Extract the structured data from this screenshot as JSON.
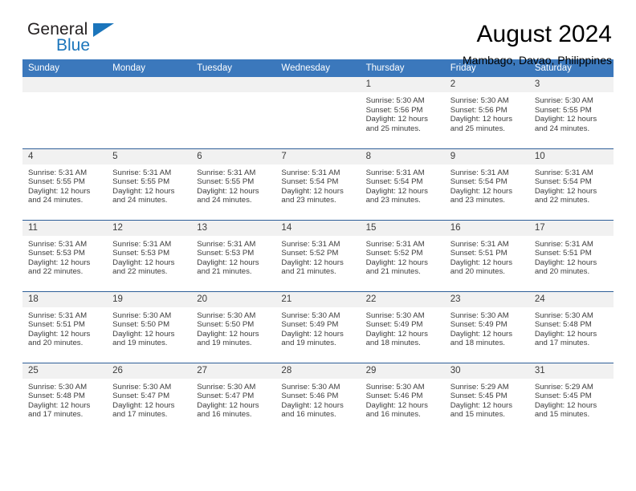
{
  "brand": {
    "line1": "General",
    "line2": "Blue",
    "triangle_color": "#1b75bb"
  },
  "header": {
    "title": "August 2024",
    "subtitle": "Mambago, Davao, Philippines"
  },
  "colors": {
    "header_blue": "#3b78bc",
    "row_border": "#2e5f98",
    "daynum_bg": "#f1f1f1",
    "text": "#3c3c3c"
  },
  "weekdays": [
    "Sunday",
    "Monday",
    "Tuesday",
    "Wednesday",
    "Thursday",
    "Friday",
    "Saturday"
  ],
  "labels": {
    "sunrise_prefix": "Sunrise:",
    "sunset_prefix": "Sunset:",
    "daylight_prefix": "Daylight:"
  },
  "weeks": [
    [
      {
        "empty": true
      },
      {
        "empty": true
      },
      {
        "empty": true
      },
      {
        "empty": true
      },
      {
        "day": "1",
        "sunrise": "Sunrise: 5:30 AM",
        "sunset": "Sunset: 5:56 PM",
        "daylight_l1": "Daylight: 12 hours",
        "daylight_l2": "and 25 minutes."
      },
      {
        "day": "2",
        "sunrise": "Sunrise: 5:30 AM",
        "sunset": "Sunset: 5:56 PM",
        "daylight_l1": "Daylight: 12 hours",
        "daylight_l2": "and 25 minutes."
      },
      {
        "day": "3",
        "sunrise": "Sunrise: 5:30 AM",
        "sunset": "Sunset: 5:55 PM",
        "daylight_l1": "Daylight: 12 hours",
        "daylight_l2": "and 24 minutes."
      }
    ],
    [
      {
        "day": "4",
        "sunrise": "Sunrise: 5:31 AM",
        "sunset": "Sunset: 5:55 PM",
        "daylight_l1": "Daylight: 12 hours",
        "daylight_l2": "and 24 minutes."
      },
      {
        "day": "5",
        "sunrise": "Sunrise: 5:31 AM",
        "sunset": "Sunset: 5:55 PM",
        "daylight_l1": "Daylight: 12 hours",
        "daylight_l2": "and 24 minutes."
      },
      {
        "day": "6",
        "sunrise": "Sunrise: 5:31 AM",
        "sunset": "Sunset: 5:55 PM",
        "daylight_l1": "Daylight: 12 hours",
        "daylight_l2": "and 24 minutes."
      },
      {
        "day": "7",
        "sunrise": "Sunrise: 5:31 AM",
        "sunset": "Sunset: 5:54 PM",
        "daylight_l1": "Daylight: 12 hours",
        "daylight_l2": "and 23 minutes."
      },
      {
        "day": "8",
        "sunrise": "Sunrise: 5:31 AM",
        "sunset": "Sunset: 5:54 PM",
        "daylight_l1": "Daylight: 12 hours",
        "daylight_l2": "and 23 minutes."
      },
      {
        "day": "9",
        "sunrise": "Sunrise: 5:31 AM",
        "sunset": "Sunset: 5:54 PM",
        "daylight_l1": "Daylight: 12 hours",
        "daylight_l2": "and 23 minutes."
      },
      {
        "day": "10",
        "sunrise": "Sunrise: 5:31 AM",
        "sunset": "Sunset: 5:54 PM",
        "daylight_l1": "Daylight: 12 hours",
        "daylight_l2": "and 22 minutes."
      }
    ],
    [
      {
        "day": "11",
        "sunrise": "Sunrise: 5:31 AM",
        "sunset": "Sunset: 5:53 PM",
        "daylight_l1": "Daylight: 12 hours",
        "daylight_l2": "and 22 minutes."
      },
      {
        "day": "12",
        "sunrise": "Sunrise: 5:31 AM",
        "sunset": "Sunset: 5:53 PM",
        "daylight_l1": "Daylight: 12 hours",
        "daylight_l2": "and 22 minutes."
      },
      {
        "day": "13",
        "sunrise": "Sunrise: 5:31 AM",
        "sunset": "Sunset: 5:53 PM",
        "daylight_l1": "Daylight: 12 hours",
        "daylight_l2": "and 21 minutes."
      },
      {
        "day": "14",
        "sunrise": "Sunrise: 5:31 AM",
        "sunset": "Sunset: 5:52 PM",
        "daylight_l1": "Daylight: 12 hours",
        "daylight_l2": "and 21 minutes."
      },
      {
        "day": "15",
        "sunrise": "Sunrise: 5:31 AM",
        "sunset": "Sunset: 5:52 PM",
        "daylight_l1": "Daylight: 12 hours",
        "daylight_l2": "and 21 minutes."
      },
      {
        "day": "16",
        "sunrise": "Sunrise: 5:31 AM",
        "sunset": "Sunset: 5:51 PM",
        "daylight_l1": "Daylight: 12 hours",
        "daylight_l2": "and 20 minutes."
      },
      {
        "day": "17",
        "sunrise": "Sunrise: 5:31 AM",
        "sunset": "Sunset: 5:51 PM",
        "daylight_l1": "Daylight: 12 hours",
        "daylight_l2": "and 20 minutes."
      }
    ],
    [
      {
        "day": "18",
        "sunrise": "Sunrise: 5:31 AM",
        "sunset": "Sunset: 5:51 PM",
        "daylight_l1": "Daylight: 12 hours",
        "daylight_l2": "and 20 minutes."
      },
      {
        "day": "19",
        "sunrise": "Sunrise: 5:30 AM",
        "sunset": "Sunset: 5:50 PM",
        "daylight_l1": "Daylight: 12 hours",
        "daylight_l2": "and 19 minutes."
      },
      {
        "day": "20",
        "sunrise": "Sunrise: 5:30 AM",
        "sunset": "Sunset: 5:50 PM",
        "daylight_l1": "Daylight: 12 hours",
        "daylight_l2": "and 19 minutes."
      },
      {
        "day": "21",
        "sunrise": "Sunrise: 5:30 AM",
        "sunset": "Sunset: 5:49 PM",
        "daylight_l1": "Daylight: 12 hours",
        "daylight_l2": "and 19 minutes."
      },
      {
        "day": "22",
        "sunrise": "Sunrise: 5:30 AM",
        "sunset": "Sunset: 5:49 PM",
        "daylight_l1": "Daylight: 12 hours",
        "daylight_l2": "and 18 minutes."
      },
      {
        "day": "23",
        "sunrise": "Sunrise: 5:30 AM",
        "sunset": "Sunset: 5:49 PM",
        "daylight_l1": "Daylight: 12 hours",
        "daylight_l2": "and 18 minutes."
      },
      {
        "day": "24",
        "sunrise": "Sunrise: 5:30 AM",
        "sunset": "Sunset: 5:48 PM",
        "daylight_l1": "Daylight: 12 hours",
        "daylight_l2": "and 17 minutes."
      }
    ],
    [
      {
        "day": "25",
        "sunrise": "Sunrise: 5:30 AM",
        "sunset": "Sunset: 5:48 PM",
        "daylight_l1": "Daylight: 12 hours",
        "daylight_l2": "and 17 minutes."
      },
      {
        "day": "26",
        "sunrise": "Sunrise: 5:30 AM",
        "sunset": "Sunset: 5:47 PM",
        "daylight_l1": "Daylight: 12 hours",
        "daylight_l2": "and 17 minutes."
      },
      {
        "day": "27",
        "sunrise": "Sunrise: 5:30 AM",
        "sunset": "Sunset: 5:47 PM",
        "daylight_l1": "Daylight: 12 hours",
        "daylight_l2": "and 16 minutes."
      },
      {
        "day": "28",
        "sunrise": "Sunrise: 5:30 AM",
        "sunset": "Sunset: 5:46 PM",
        "daylight_l1": "Daylight: 12 hours",
        "daylight_l2": "and 16 minutes."
      },
      {
        "day": "29",
        "sunrise": "Sunrise: 5:30 AM",
        "sunset": "Sunset: 5:46 PM",
        "daylight_l1": "Daylight: 12 hours",
        "daylight_l2": "and 16 minutes."
      },
      {
        "day": "30",
        "sunrise": "Sunrise: 5:29 AM",
        "sunset": "Sunset: 5:45 PM",
        "daylight_l1": "Daylight: 12 hours",
        "daylight_l2": "and 15 minutes."
      },
      {
        "day": "31",
        "sunrise": "Sunrise: 5:29 AM",
        "sunset": "Sunset: 5:45 PM",
        "daylight_l1": "Daylight: 12 hours",
        "daylight_l2": "and 15 minutes."
      }
    ]
  ]
}
